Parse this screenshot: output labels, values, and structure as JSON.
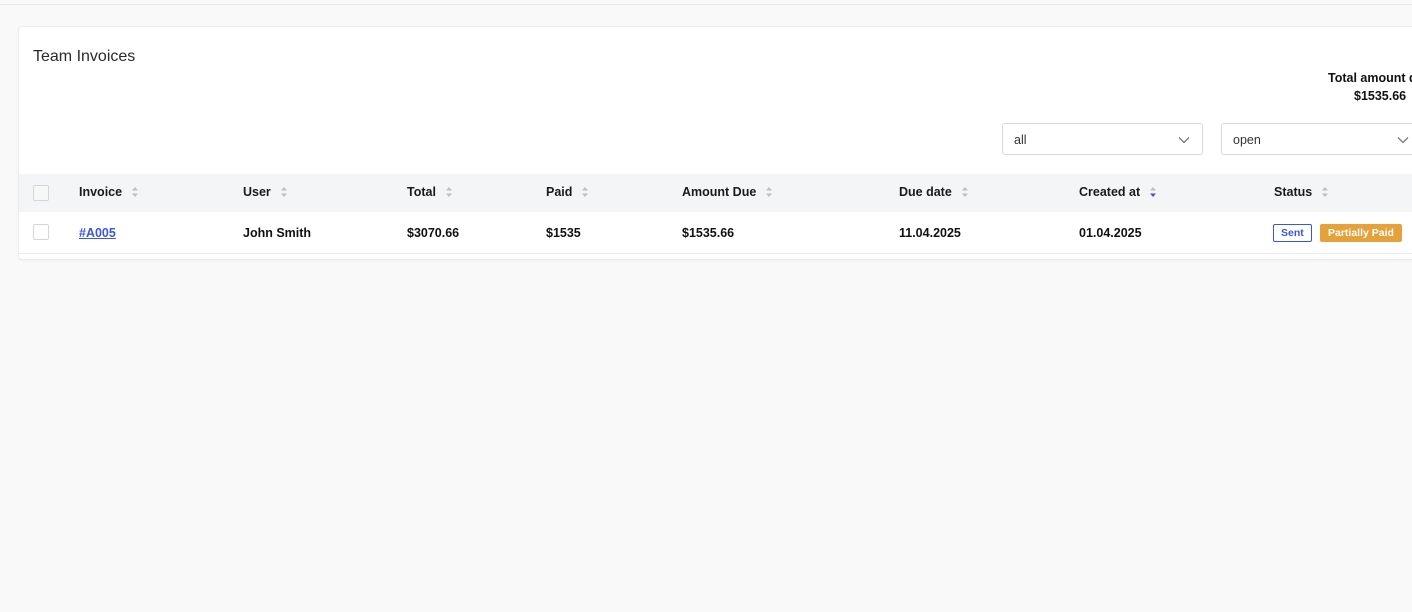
{
  "card": {
    "title": "Team Invoices",
    "total_label": "Total amount d",
    "total_amount": "$1535.66"
  },
  "filters": {
    "first": {
      "value": "all"
    },
    "second": {
      "value": "open"
    }
  },
  "table": {
    "columns": [
      {
        "label": "Invoice",
        "sort": "none"
      },
      {
        "label": "User",
        "sort": "none"
      },
      {
        "label": "Total",
        "sort": "none"
      },
      {
        "label": "Paid",
        "sort": "none"
      },
      {
        "label": "Amount Due",
        "sort": "none"
      },
      {
        "label": "Due date",
        "sort": "none"
      },
      {
        "label": "Created at",
        "sort": "desc"
      },
      {
        "label": "Status",
        "sort": "none"
      }
    ],
    "rows": [
      {
        "invoice": "#A005",
        "user": "John Smith",
        "total": "$3070.66",
        "paid": "$1535",
        "amount_due": "$1535.66",
        "due_date": "11.04.2025",
        "created_at": "01.04.2025",
        "status_badges": [
          "Sent",
          "Partially Paid"
        ]
      }
    ]
  },
  "colors": {
    "accent": "#3b57d6",
    "partial_badge": "#e5a13a",
    "header_bg": "#f4f5f6",
    "page_bg": "#f9f9f9"
  },
  "icons": {
    "select_chevron": "chevron-down-icon",
    "sort_neutral": "sort-icon",
    "sort_active": "sort-desc-icon"
  }
}
